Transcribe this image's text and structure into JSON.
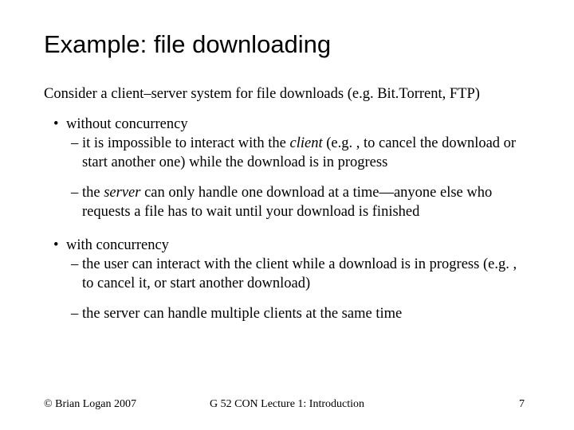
{
  "title": "Example: file downloading",
  "intro": "Consider a client–server system for file downloads (e.g. Bit.Torrent, FTP)",
  "bullets": [
    {
      "label": "without concurrency",
      "dashes": [
        {
          "pre": "it is impossible to interact with the ",
          "em": "client",
          "post": " (e.g. , to cancel the download or start another one) while the download is in progress"
        },
        {
          "pre": "the ",
          "em": "server",
          "post": " can only handle one download at a time—anyone else who requests a file has to wait until your download is finished"
        }
      ]
    },
    {
      "label": "with concurrency",
      "dashes": [
        {
          "pre": "the user can interact with the client while a download is in progress (e.g. , to cancel it, or start another download)",
          "em": "",
          "post": ""
        },
        {
          "pre": "the server can handle multiple clients at the same time",
          "em": "",
          "post": ""
        }
      ]
    }
  ],
  "footer": {
    "left": "© Brian Logan 2007",
    "center": "G 52 CON Lecture 1: Introduction",
    "right": "7"
  }
}
